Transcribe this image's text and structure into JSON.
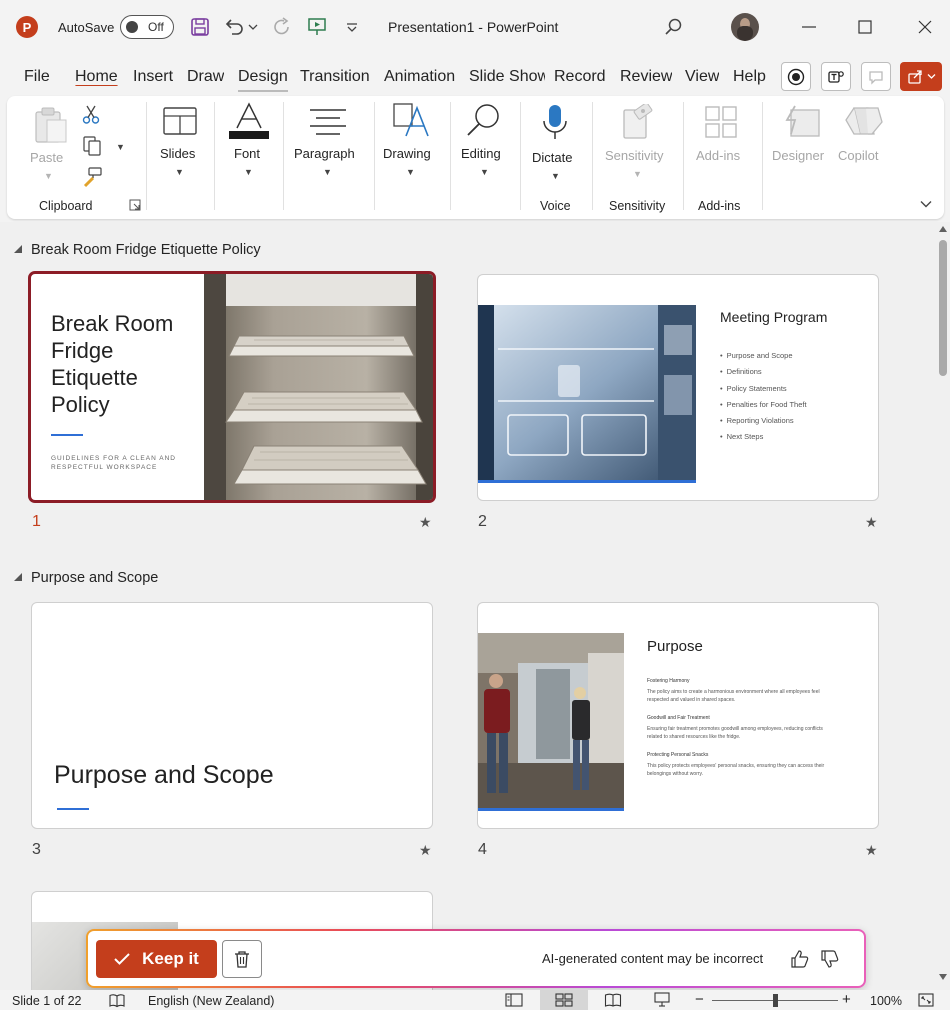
{
  "titlebar": {
    "app_logo": "P",
    "autosave_label": "AutoSave",
    "autosave_state": "Off",
    "document_title": "Presentation1  -  PowerPoint"
  },
  "tabs": [
    {
      "label": "File"
    },
    {
      "label": "Home"
    },
    {
      "label": "Insert"
    },
    {
      "label": "Draw"
    },
    {
      "label": "Design"
    },
    {
      "label": "Transition"
    },
    {
      "label": "Animation"
    },
    {
      "label": "Slide Show"
    },
    {
      "label": "Record"
    },
    {
      "label": "Review"
    },
    {
      "label": "View"
    },
    {
      "label": "Help"
    }
  ],
  "ribbon": {
    "paste": "Paste",
    "clipboard_group": "Clipboard",
    "slides": "Slides",
    "font": "Font",
    "paragraph": "Paragraph",
    "drawing": "Drawing",
    "editing": "Editing",
    "dictate": "Dictate",
    "voice_group": "Voice",
    "sensitivity": "Sensitivity",
    "sensitivity_group": "Sensitivity",
    "addins": "Add-ins",
    "addins_group": "Add-ins",
    "designer": "Designer",
    "copilot": "Copilot"
  },
  "sections": [
    {
      "title": "Break Room Fridge Etiquette Policy"
    },
    {
      "title": "Purpose and Scope"
    }
  ],
  "slides": {
    "s1": {
      "number": "1",
      "title": "Break Room Fridge Etiquette Policy",
      "title_lines": [
        "Break Room",
        "Fridge",
        "Etiquette",
        "Policy"
      ],
      "subtitle_lines": [
        "GUIDELINES FOR A CLEAN AND",
        "RESPECTFUL WORKSPACE"
      ]
    },
    "s2": {
      "number": "2",
      "title": "Meeting Program",
      "bullets": [
        "Purpose and Scope",
        "Definitions",
        "Policy Statements",
        "Penalties for Food Theft",
        "Reporting Violations",
        "Next Steps"
      ]
    },
    "s3": {
      "number": "3",
      "title": "Purpose and Scope"
    },
    "s4": {
      "number": "4",
      "title": "Purpose",
      "items": [
        {
          "heading": "Fostering Harmony",
          "lines": [
            "The policy aims to create a harmonious environment where all employees feel",
            "respected and valued in shared spaces."
          ]
        },
        {
          "heading": "Goodwill and Fair Treatment",
          "lines": [
            "Ensuring fair treatment promotes goodwill among employees, reducing conflicts",
            "related to shared resources like the fridge."
          ]
        },
        {
          "heading": "Protecting Personal Snacks",
          "lines": [
            "This policy protects employees' personal snacks, ensuring they can access their",
            "belongings without worry."
          ]
        }
      ]
    }
  },
  "ai_bar": {
    "keep_label": "Keep it",
    "note": "AI-generated content may be incorrect"
  },
  "statusbar": {
    "slide_info": "Slide 1 of 22",
    "language": "English (New Zealand)",
    "zoom": "100%",
    "zoom_level_percent": 100
  },
  "colors": {
    "accent": "#c43e1c",
    "selected_border": "#8c1c26",
    "slide_accent_line": "#2f6fd6"
  }
}
